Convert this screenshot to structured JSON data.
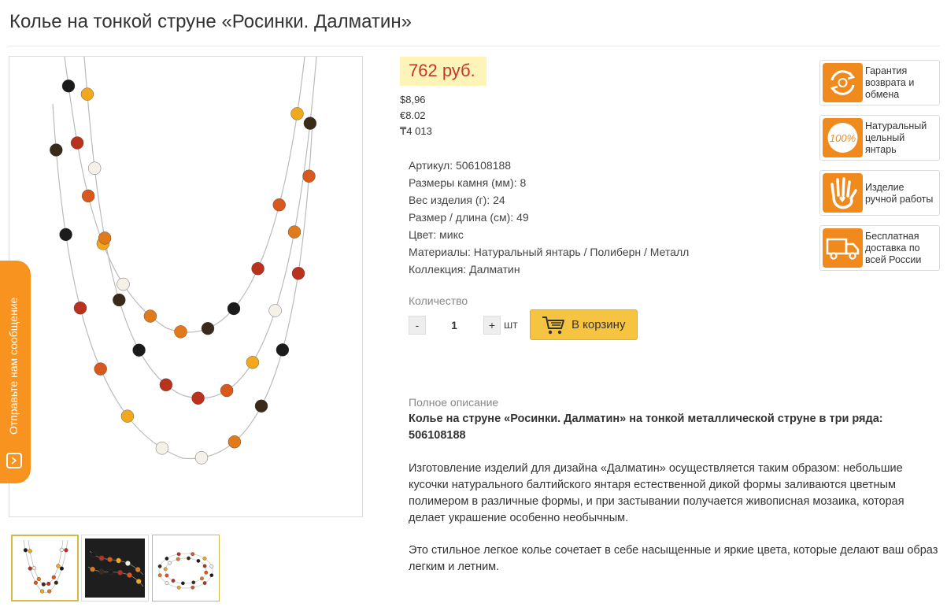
{
  "product": {
    "title": "Колье на тонкой струне «Росинки. Далматин»"
  },
  "price": {
    "main": "762 руб.",
    "usd": "$8,96",
    "eur": "€8.02",
    "kzt": "₸4 013"
  },
  "specs": [
    {
      "key": "Артикул:",
      "value": "506108188"
    },
    {
      "key": "Размеры камня (мм):",
      "value": "8"
    },
    {
      "key": "Вес изделия (г):",
      "value": "24"
    },
    {
      "key": "Размер / длина (см):",
      "value": "49"
    },
    {
      "key": "Цвет:",
      "value": "микс"
    },
    {
      "key": "Материалы:",
      "value": "Натуральный янтарь / Полиберн / Металл"
    },
    {
      "key": "Коллекция:",
      "value": "Далматин"
    }
  ],
  "quantity": {
    "label": "Количество",
    "minus": "-",
    "value": "1",
    "plus": "+",
    "unit": "шт"
  },
  "cart": {
    "label": "В корзину"
  },
  "description": {
    "label": "Полное описание",
    "title": "Колье на струне «Росинки. Далматин» на тонкой металлической струне в три ряда: 506108188",
    "p1": "Изготовление изделий для дизайна «Далматин» осуществляется таким образом: небольшие кусочки натурального балтийского янтаря естественной дикой формы заливаются цветным полимером в различные формы, и при застывании получается живописная мозаика, которая делает украшение особенно необычным.",
    "p2": "Это стильное легкое колье сочетает в себе насыщенные и яркие цвета, которые делают ваш образ легким и летним."
  },
  "badges": [
    {
      "icon": "return-exchange-icon",
      "text": "Гарантия возврата и обмена"
    },
    {
      "icon": "100-percent-icon",
      "text": "Натуральный цельный янтарь"
    },
    {
      "icon": "hand-heart-icon",
      "text": "Изделие ручной работы"
    },
    {
      "icon": "delivery-truck-icon",
      "text": "Бесплатная доставка по всей России"
    }
  ],
  "feedback": {
    "label": "Отправьте нам сообщение"
  },
  "colors": {
    "accent_orange": "#f7931e",
    "price_bg": "#fff4b8",
    "price_text": "#c0392b",
    "cart_button": "#f6c441"
  }
}
